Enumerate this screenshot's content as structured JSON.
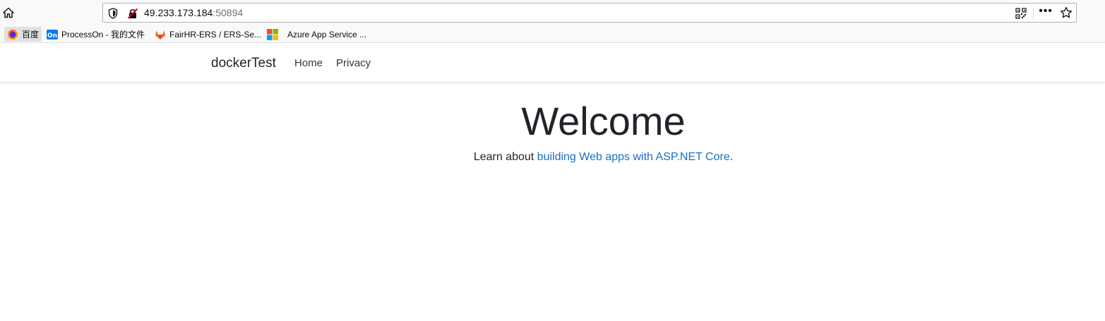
{
  "browser": {
    "url_host": "49.233.173.184",
    "url_port": ":50894",
    "more_label": "•••"
  },
  "bookmarks": [
    {
      "label": "百度",
      "icon": "firefox-icon"
    },
    {
      "label": "ProcessOn - 我的文件",
      "icon": "processon-icon"
    },
    {
      "label": "FairHR-ERS / ERS-Se...",
      "icon": "gitlab-icon"
    },
    {
      "label": "Azure App Service ...",
      "icon": "microsoft-icon"
    }
  ],
  "navbar": {
    "brand": "dockerTest",
    "links": [
      "Home",
      "Privacy"
    ]
  },
  "main": {
    "heading": "Welcome",
    "learn_prefix": "Learn about ",
    "learn_link": "building Web apps with ASP.NET Core",
    "learn_suffix": "."
  },
  "colors": {
    "link": "#1b6ec2",
    "text": "#212529",
    "chrome": "#f9f9fa"
  }
}
